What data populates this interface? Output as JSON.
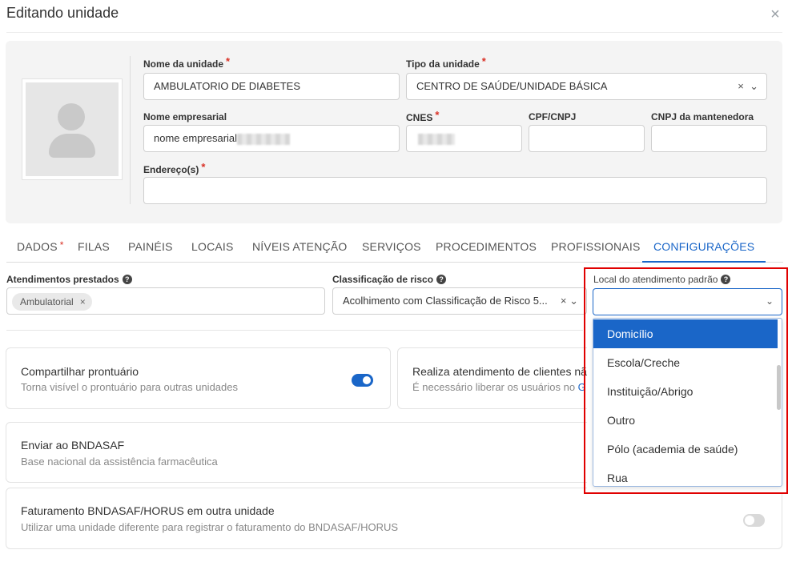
{
  "modal": {
    "title": "Editando unidade",
    "close_icon": "×"
  },
  "form": {
    "nome_unidade": {
      "label": "Nome da unidade",
      "value": "AMBULATORIO DE DIABETES"
    },
    "tipo_unidade": {
      "label": "Tipo da unidade",
      "value": "CENTRO DE SAÚDE/UNIDADE BÁSICA"
    },
    "nome_empresarial": {
      "label": "Nome empresarial",
      "value": "nome empresarial"
    },
    "cnes": {
      "label": "CNES",
      "value": ""
    },
    "cpf_cnpj": {
      "label": "CPF/CNPJ",
      "value": ""
    },
    "cnpj_mantenedora": {
      "label": "CNPJ da mantenedora",
      "value": ""
    },
    "enderecos": {
      "label": "Endereço(s)",
      "value": ""
    },
    "required_mark": "*",
    "clear_glyph": "×",
    "chevron_glyph": "⌄"
  },
  "tabs": [
    {
      "label": "DADOS",
      "required": true
    },
    {
      "label": "FILAS"
    },
    {
      "label": "PAINÉIS"
    },
    {
      "label": "LOCAIS"
    },
    {
      "label": "NÍVEIS ATENÇÃO"
    },
    {
      "label": "SERVIÇOS"
    },
    {
      "label": "PROCEDIMENTOS"
    },
    {
      "label": "PROFISSIONAIS"
    },
    {
      "label": "CONFIGURAÇÕES",
      "active": true
    }
  ],
  "config": {
    "atendimentos": {
      "label": "Atendimentos prestados",
      "chip": "Ambulatorial"
    },
    "classificacao": {
      "label": "Classificação de risco",
      "value": "Acolhimento com Classificação de Risco 5..."
    },
    "local_padrao": {
      "label": "Local do atendimento padrão",
      "value": ""
    },
    "help_glyph": "?"
  },
  "dropdown": {
    "options": [
      "Domicílio",
      "Escola/Creche",
      "Instituição/Abrigo",
      "Outro",
      "Pólo (academia de saúde)",
      "Rua"
    ],
    "selected_index": 0
  },
  "cards": {
    "compartilhar": {
      "title": "Compartilhar prontuário",
      "desc": "Torna visível o prontuário para outras unidades",
      "toggle_on": true
    },
    "realiza": {
      "title": "Realiza atendimento de clientes nã",
      "desc_prefix": "É necessário liberar os usuários no ",
      "desc_link": "G"
    },
    "bndasaf": {
      "title": "Enviar ao BNDASAF",
      "desc": "Base nacional da assistência farmacêutica"
    },
    "faturamento": {
      "title": "Faturamento BNDASAF/HORUS em outra unidade",
      "desc": "Utilizar uma unidade diferente para registrar o faturamento do BNDASAF/HORUS",
      "toggle_on": false
    }
  },
  "colors": {
    "accent": "#1a66c8",
    "required": "#d93025",
    "highlight": "#e00000"
  }
}
